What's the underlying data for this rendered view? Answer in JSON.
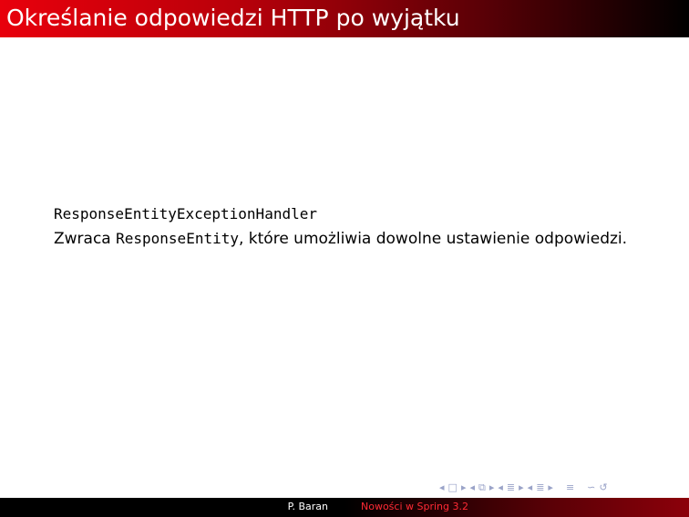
{
  "slide": {
    "title": "Określanie odpowiedzi HTTP po wyjątku",
    "class_name": "ResponseEntityExceptionHandler",
    "line2_prefix": "Zwraca ",
    "line2_code": "ResponseEntity",
    "line2_suffix": ", które umożliwia dowolne ustawienie odpowiedzi."
  },
  "nav": {
    "icons": [
      {
        "name": "prev-frame-icon",
        "glyph": "◂"
      },
      {
        "name": "frame-icon",
        "glyph": "□"
      },
      {
        "name": "next-frame-icon",
        "glyph": "▸"
      },
      {
        "name": "prev-subsection-icon",
        "glyph": "◂"
      },
      {
        "name": "subsection-icon",
        "glyph": "⧉"
      },
      {
        "name": "next-subsection-icon",
        "glyph": "▸"
      },
      {
        "name": "prev-section-icon",
        "glyph": "◂"
      },
      {
        "name": "section-icon",
        "glyph": "≣"
      },
      {
        "name": "next-section-icon",
        "glyph": "▸"
      },
      {
        "name": "prev-doc-icon",
        "glyph": "◂"
      },
      {
        "name": "doc-icon",
        "glyph": "≣"
      },
      {
        "name": "next-doc-icon",
        "glyph": "▸"
      },
      {
        "name": "align-icon",
        "glyph": "≡"
      },
      {
        "name": "search-icon",
        "glyph": "∽"
      },
      {
        "name": "back-icon",
        "glyph": "↺"
      }
    ]
  },
  "footer": {
    "author": "P. Baran",
    "talk_title": "Nowości w Spring 3.2"
  },
  "colors": {
    "title_gradient_start": "#e8000c",
    "title_gradient_end": "#000000",
    "footer_title_text": "#ff2a35",
    "nav_icon": "#9aa3c8"
  }
}
